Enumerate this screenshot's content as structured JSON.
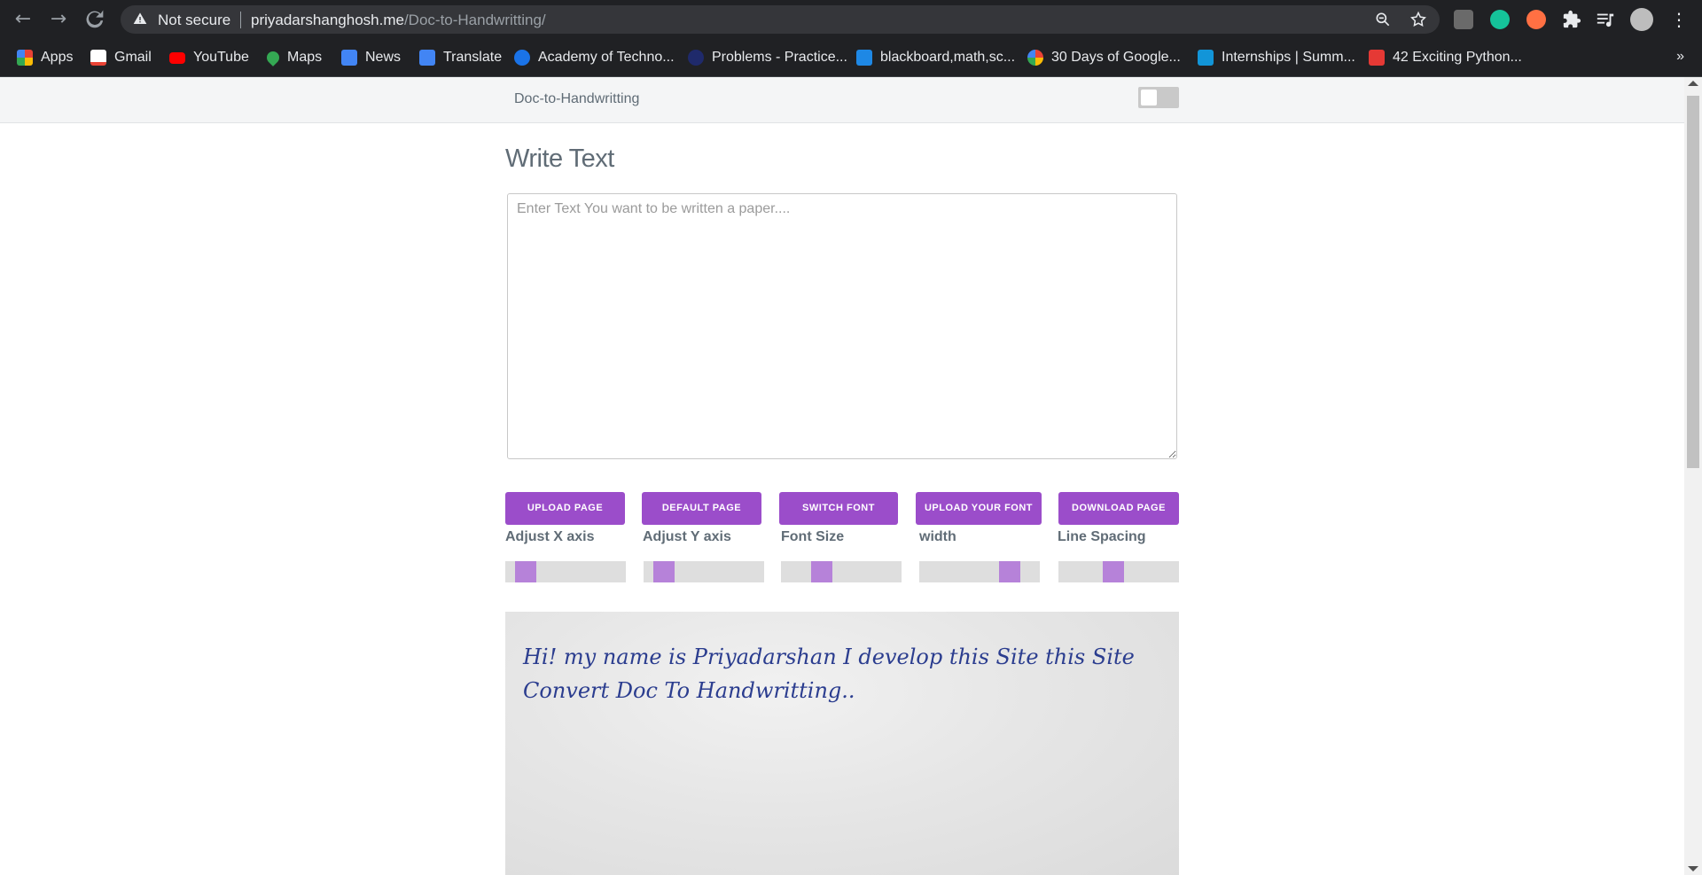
{
  "browser": {
    "security_label": "Not secure",
    "url_host": "priyadarshanghosh.me",
    "url_path": "/Doc-to-Handwritting/",
    "bookmarks": [
      {
        "label": "Apps",
        "icon": "apps-grid-icon",
        "color": "#ea4335"
      },
      {
        "label": "Gmail",
        "icon": "gmail-icon",
        "color": "#ea4335"
      },
      {
        "label": "YouTube",
        "icon": "youtube-icon",
        "color": "#ff0000"
      },
      {
        "label": "Maps",
        "icon": "maps-icon",
        "color": "#34a853"
      },
      {
        "label": "News",
        "icon": "news-icon",
        "color": "#4285f4"
      },
      {
        "label": "Translate",
        "icon": "translate-icon",
        "color": "#4285f4"
      },
      {
        "label": "Academy of Techno...",
        "icon": "academy-icon",
        "color": "#1a73e8"
      },
      {
        "label": "Problems - Practice...",
        "icon": "practice-icon",
        "color": "#1f2a6b"
      },
      {
        "label": "blackboard,math,sc...",
        "icon": "blackboard-icon",
        "color": "#1e88e5"
      },
      {
        "label": "30 Days of Google...",
        "icon": "google-icon",
        "color": "#ffffff"
      },
      {
        "label": "Internships | Summ...",
        "icon": "internshala-icon",
        "color": "#1295d8"
      },
      {
        "label": "42 Exciting Python...",
        "icon": "python-article-icon",
        "color": "#e53935"
      }
    ],
    "more_bookmarks": "»"
  },
  "app": {
    "brand": "Doc-to-Handwritting",
    "heading": "Write Text",
    "textarea_placeholder": "Enter Text You want to be written a paper....",
    "buttons": [
      {
        "label": "UPLOAD PAGE"
      },
      {
        "label": "DEFAULT PAGE"
      },
      {
        "label": "SWITCH FONT"
      },
      {
        "label": "UPLOAD YOUR FONT"
      },
      {
        "label": "DOWNLOAD PAGE"
      }
    ],
    "sliders": [
      {
        "label": "Adjust X axis",
        "value": 0.1
      },
      {
        "label": "Adjust Y axis",
        "value": 0.1
      },
      {
        "label": "Font Size",
        "value": 0.3
      },
      {
        "label": "width",
        "value": 0.8
      },
      {
        "label": "Line Spacing",
        "value": 0.45
      }
    ],
    "accent_color": "#9b4dca",
    "paper_text": "Hi! my name is Priyadarshan I develop this Site this Site Convert Doc To Handwritting.."
  }
}
